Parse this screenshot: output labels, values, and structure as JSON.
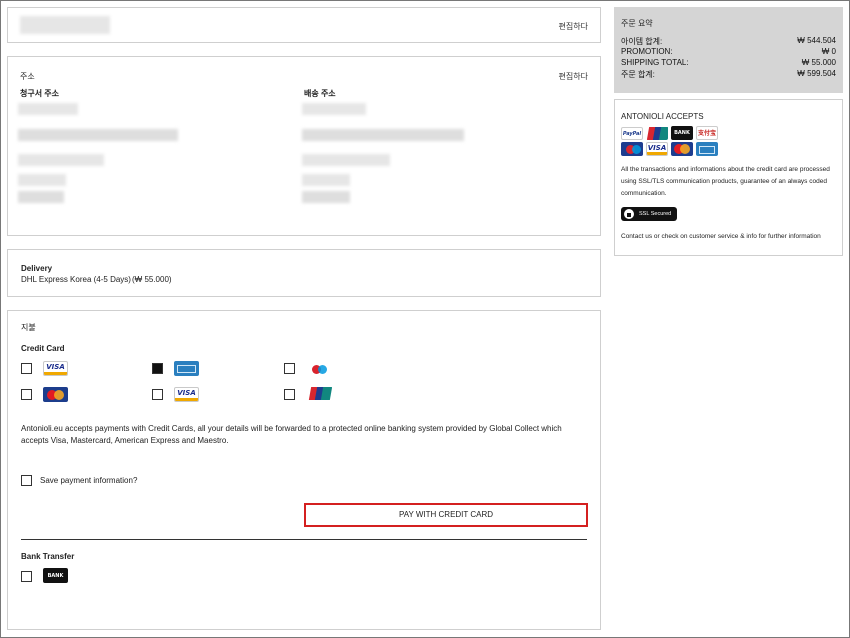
{
  "edit_label": "편집하다",
  "address": {
    "heading": "주소",
    "billing_label": "청구서 주소",
    "shipping_label": "배송 주소"
  },
  "delivery": {
    "heading": "Delivery",
    "method": "DHL Express Korea (4-5 Days)",
    "price": "(₩ 55.000)"
  },
  "payment": {
    "heading": "지불",
    "credit_card_label": "Credit Card",
    "card_options": [
      {
        "icon": "visa-icon",
        "checked": false
      },
      {
        "icon": "amex-icon",
        "checked": true
      },
      {
        "icon": "maestro-icon",
        "checked": false
      },
      {
        "icon": "mastercard-icon",
        "checked": false
      },
      {
        "icon": "visa-icon",
        "checked": false
      },
      {
        "icon": "unionpay-icon",
        "checked": false
      }
    ],
    "info_text": "Antonioli.eu accepts payments with Credit Cards, all your details will be forwarded to a protected online banking system provided by Global Collect which accepts Visa, Mastercard, American Express and Maestro.",
    "save_label": "Save payment information?",
    "pay_button": "PAY WITH CREDIT CARD",
    "bank_transfer_label": "Bank Transfer",
    "bank_logo_text": "BANK"
  },
  "summary": {
    "heading": "주문 요약",
    "rows": [
      {
        "label": "아이템 합계:",
        "value": "₩ 544.504"
      },
      {
        "label": "PROMOTION:",
        "value": "₩ 0"
      },
      {
        "label": "SHIPPING TOTAL:",
        "value": "₩ 55.000"
      },
      {
        "label": "주문 합계:",
        "value": "₩ 599.504"
      }
    ]
  },
  "accepts": {
    "heading": "ANTONIOLI ACCEPTS",
    "logos": [
      "paypal-icon",
      "unionpay-icon",
      "bank-icon",
      "alipay-icon",
      "maestro-icon",
      "visa-icon",
      "mastercard-icon",
      "amex-icon"
    ],
    "paypal_text": "PayPal",
    "bank_text": "BANK",
    "alipay_text": "支付宝",
    "visa_text": "VISA",
    "info_text": "All the transactions and informations about the credit card are processed using SSL/TLS communication products, guarantee of an always coded communication.",
    "ssl_badge": "SSL Secured",
    "contact_text": "Contact us or check on customer service & info for further information"
  },
  "colors": {
    "highlight_border": "#d42020",
    "summary_bg": "#d5d5d5"
  }
}
